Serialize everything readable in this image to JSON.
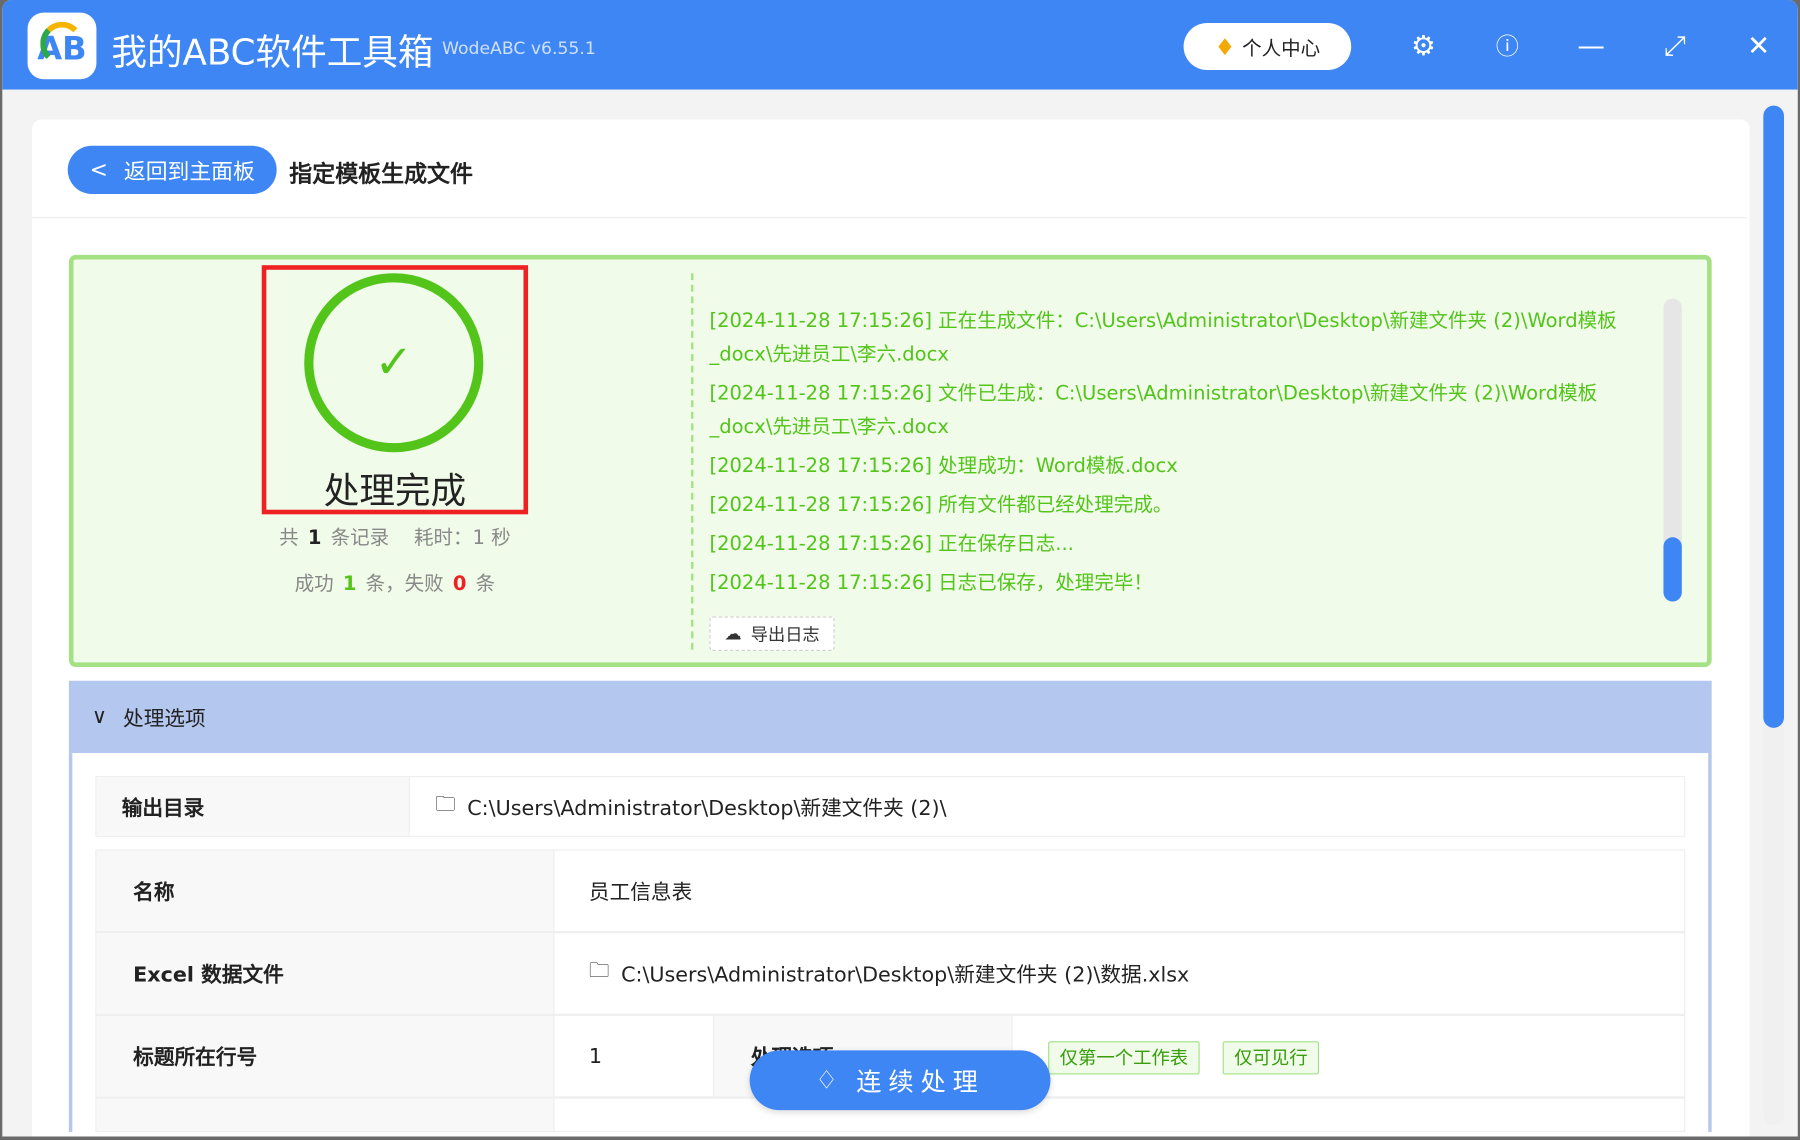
{
  "app": {
    "title": "我的ABC软件工具箱",
    "version": "WodeABC v6.55.1",
    "logo_text": "AB",
    "user_center": "个人中心"
  },
  "page": {
    "back_label": "返回到主面板",
    "title": "指定模板生成文件"
  },
  "result": {
    "status": "处理完成",
    "total_prefix": "共",
    "total": "1",
    "total_suffix": "条记录",
    "time_label": "耗时：1 秒",
    "success_prefix": "成功",
    "success": "1",
    "success_suffix": "条，失败",
    "fail": "0",
    "fail_suffix": "条"
  },
  "log": {
    "lines": [
      "[2024-11-28 17:15:26] 正在生成文件：C:\\Users\\Administrator\\Desktop\\新建文件夹 (2)\\Word模板_docx\\先进员工\\李六.docx",
      "[2024-11-28 17:15:26] 文件已生成：C:\\Users\\Administrator\\Desktop\\新建文件夹 (2)\\Word模板_docx\\先进员工\\李六.docx",
      "[2024-11-28 17:15:26] 处理成功：Word模板.docx",
      "[2024-11-28 17:15:26] 所有文件都已经处理完成。",
      "[2024-11-28 17:15:26] 正在保存日志...",
      "[2024-11-28 17:15:26] 日志已保存，处理完毕！"
    ],
    "export_label": "导出日志"
  },
  "options": {
    "header": "处理选项",
    "output_dir_label": "输出目录",
    "output_dir": "C:\\Users\\Administrator\\Desktop\\新建文件夹 (2)\\",
    "name_label": "名称",
    "name": "员工信息表",
    "excel_label": "Excel 数据文件",
    "excel": "C:\\Users\\Administrator\\Desktop\\新建文件夹 (2)\\数据.xlsx",
    "header_row_label": "标题所在行号",
    "header_row": "1",
    "process_label": "处理选项",
    "tags": [
      "仅第一个工作表",
      "仅可见行"
    ]
  },
  "action": {
    "continue_label": "连续处理"
  }
}
